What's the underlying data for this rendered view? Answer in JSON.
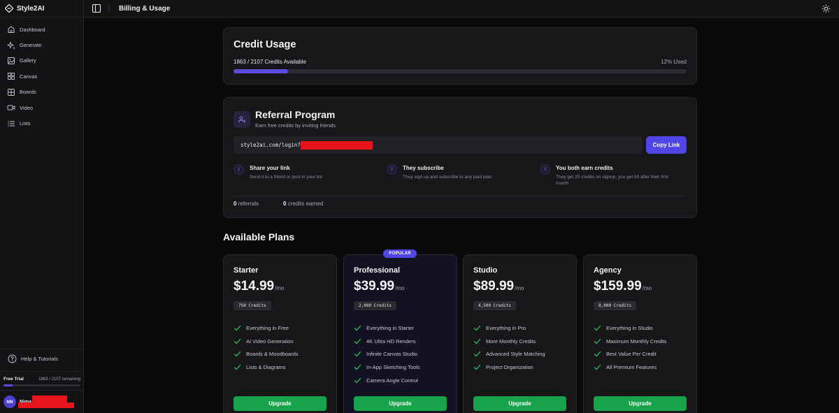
{
  "app": {
    "brand": "Style2AI",
    "page_title": "Billing & Usage"
  },
  "sidebar": {
    "items": [
      {
        "label": "Dashboard",
        "icon": "home-icon"
      },
      {
        "label": "Generate",
        "icon": "sparkles-icon"
      },
      {
        "label": "Gallery",
        "icon": "image-icon"
      },
      {
        "label": "Canvas",
        "icon": "grid-icon"
      },
      {
        "label": "Boards",
        "icon": "board-icon"
      },
      {
        "label": "Video",
        "icon": "video-icon"
      },
      {
        "label": "Lists",
        "icon": "list-icon"
      }
    ],
    "help_label": "Help & Tutorials",
    "trial": {
      "label": "Free Trial",
      "remaining": "1863 / 2107 remaining",
      "progress_fraction": 0.12
    },
    "user": {
      "initials": "NN",
      "name": "Nima"
    }
  },
  "credit_usage": {
    "title": "Credit Usage",
    "available_text": "1863 / 2107 Credits Available",
    "used_text": "12% Used",
    "used_fraction": 0.12
  },
  "referral": {
    "title": "Referral Program",
    "subtitle": "Earn free credits by inviting friends",
    "link": "style2ai.com/login?r",
    "copy_label": "Copy Link",
    "steps": [
      {
        "num": "1",
        "title": "Share your link",
        "desc": "Send it to a friend or post in your bio"
      },
      {
        "num": "2",
        "title": "They subscribe",
        "desc": "They sign up and subscribe to any paid plan"
      },
      {
        "num": "3",
        "title": "You both earn credits",
        "desc": "They get 25 credits on signup, you get 50 after their first month"
      }
    ],
    "stats": {
      "referrals_count": "0",
      "referrals_label": "referrals",
      "earned_count": "0",
      "earned_label": "credits earned"
    }
  },
  "plans": {
    "title": "Available Plans",
    "popular_badge": "POPULAR",
    "items": [
      {
        "name": "Starter",
        "price": "$14.99",
        "period": "/mo",
        "credits": "750 Credits",
        "features": [
          "Everything in Free",
          "AI Video Generation",
          "Boards & Moodboards",
          "Lists & Diagrams"
        ],
        "button": "Upgrade"
      },
      {
        "name": "Professional",
        "price": "$39.99",
        "period": "/mo",
        "credits": "2,000 Credits",
        "features": [
          "Everything in Starter",
          "4K Ultra HD Renders",
          "Infinite Canvas Studio",
          "In-App Sketching Tools",
          "Camera Angle Control"
        ],
        "button": "Upgrade"
      },
      {
        "name": "Studio",
        "price": "$89.99",
        "period": "/mo",
        "credits": "4,500 Credits",
        "features": [
          "Everything in Pro",
          "More Monthly Credits",
          "Advanced Style Matching",
          "Project Organization"
        ],
        "button": "Upgrade"
      },
      {
        "name": "Agency",
        "price": "$159.99",
        "period": "/mo",
        "credits": "8,000 Credits",
        "features": [
          "Everything in Studio",
          "Maximum Monthly Credits",
          "Best Value Per Credit",
          "All Premium Features"
        ],
        "button": "Upgrade"
      }
    ]
  },
  "colors": {
    "accent": "#4f46e5",
    "progress": "#5b4de0",
    "upgrade": "#16a34a",
    "check": "#22c55e",
    "redaction": "#e8151b"
  }
}
